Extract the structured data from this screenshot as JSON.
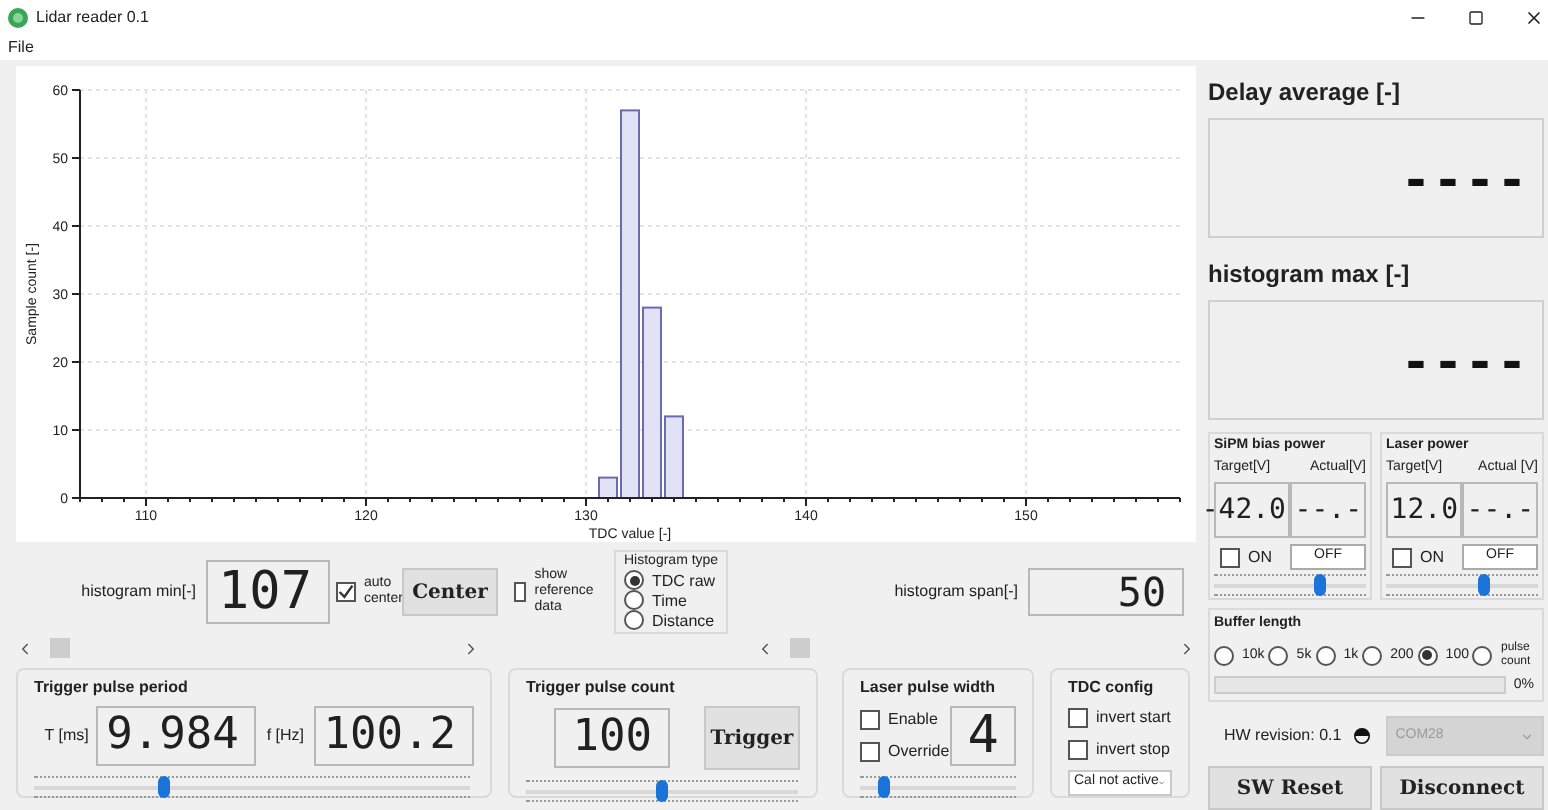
{
  "window": {
    "title": "Lidar reader 0.1"
  },
  "menu": [
    "File"
  ],
  "chart": {
    "chart_data": {
      "type": "bar",
      "xlabel": "TDC value [-]",
      "ylabel": "Sample count [-]",
      "x": [
        131,
        132,
        133,
        134
      ],
      "values": [
        3,
        57,
        28,
        12
      ],
      "grid": true,
      "xlim": [
        107,
        157
      ],
      "ylim": [
        0,
        60
      ],
      "xticks": [
        110,
        120,
        130,
        140,
        150
      ],
      "yticks": [
        0,
        10,
        20,
        30,
        40,
        50,
        60
      ]
    }
  },
  "histogram_min": {
    "label": "histogram min[-]",
    "value": "107"
  },
  "auto_center": {
    "label": "auto center",
    "checked": true
  },
  "center_button": "Center",
  "show_reference": {
    "label": "show reference data",
    "checked": false
  },
  "histogram_type": {
    "title": "Histogram type",
    "options": [
      {
        "label": "TDC raw",
        "selected": true
      },
      {
        "label": "Time",
        "selected": false
      },
      {
        "label": "Distance",
        "selected": false
      }
    ]
  },
  "histogram_span": {
    "label": "histogram span[-]",
    "value": "50"
  },
  "trigger_pulse_period": {
    "title": "Trigger pulse period",
    "period_label": "T [ms]",
    "period_value": "9.984",
    "freq_label": "f [Hz]",
    "freq_value": "100.2",
    "level": 0.3
  },
  "trigger_pulse_count": {
    "title": "Trigger pulse count",
    "value": "100",
    "level": 0.5,
    "button": "Trigger"
  },
  "laser_pulse_width": {
    "title": "Laser pulse width",
    "checkboxes": [
      {
        "label": "Enable",
        "checked": false
      },
      {
        "label": "Override",
        "checked": false
      }
    ],
    "value": "4",
    "level": 0.15
  },
  "tdc_config": {
    "title": "TDC config",
    "checkboxes": [
      {
        "label": "invert start",
        "checked": false
      },
      {
        "label": "invert stop",
        "checked": false
      }
    ],
    "dropdown": "Cal not active"
  },
  "delay_average": {
    "title": "Delay average [-]",
    "value": "----"
  },
  "histogram_max": {
    "title": "histogram max [-]",
    "value": "----"
  },
  "power_groups": [
    {
      "title": "SiPM bias power",
      "target_label": "Target[V]",
      "actual_label": "Actual[V]",
      "target": "-42.0",
      "actual": "--.-",
      "on_label": "ON",
      "on": false,
      "state_button": "OFF",
      "level": 0.7
    },
    {
      "title": "Laser power",
      "target_label": "Target[V]",
      "actual_label": "Actual [V]",
      "target": "12.0",
      "actual": "--.-",
      "on_label": "ON",
      "on": false,
      "state_button": "OFF",
      "level": 0.65
    }
  ],
  "buffer_length": {
    "title": "Buffer length",
    "options": [
      {
        "label": "10k",
        "selected": false
      },
      {
        "label": "5k",
        "selected": false
      },
      {
        "label": "1k",
        "selected": false
      },
      {
        "label": "200",
        "selected": false
      },
      {
        "label": "100",
        "selected": true
      },
      {
        "label": "pulse count",
        "selected": false
      }
    ],
    "level": 0,
    "reading": "0%"
  },
  "hw_revision": "HW revision: 0.1",
  "port": {
    "value": "COM28",
    "disabled": true
  },
  "buttons": [
    "SW Reset",
    "Disconnect"
  ]
}
